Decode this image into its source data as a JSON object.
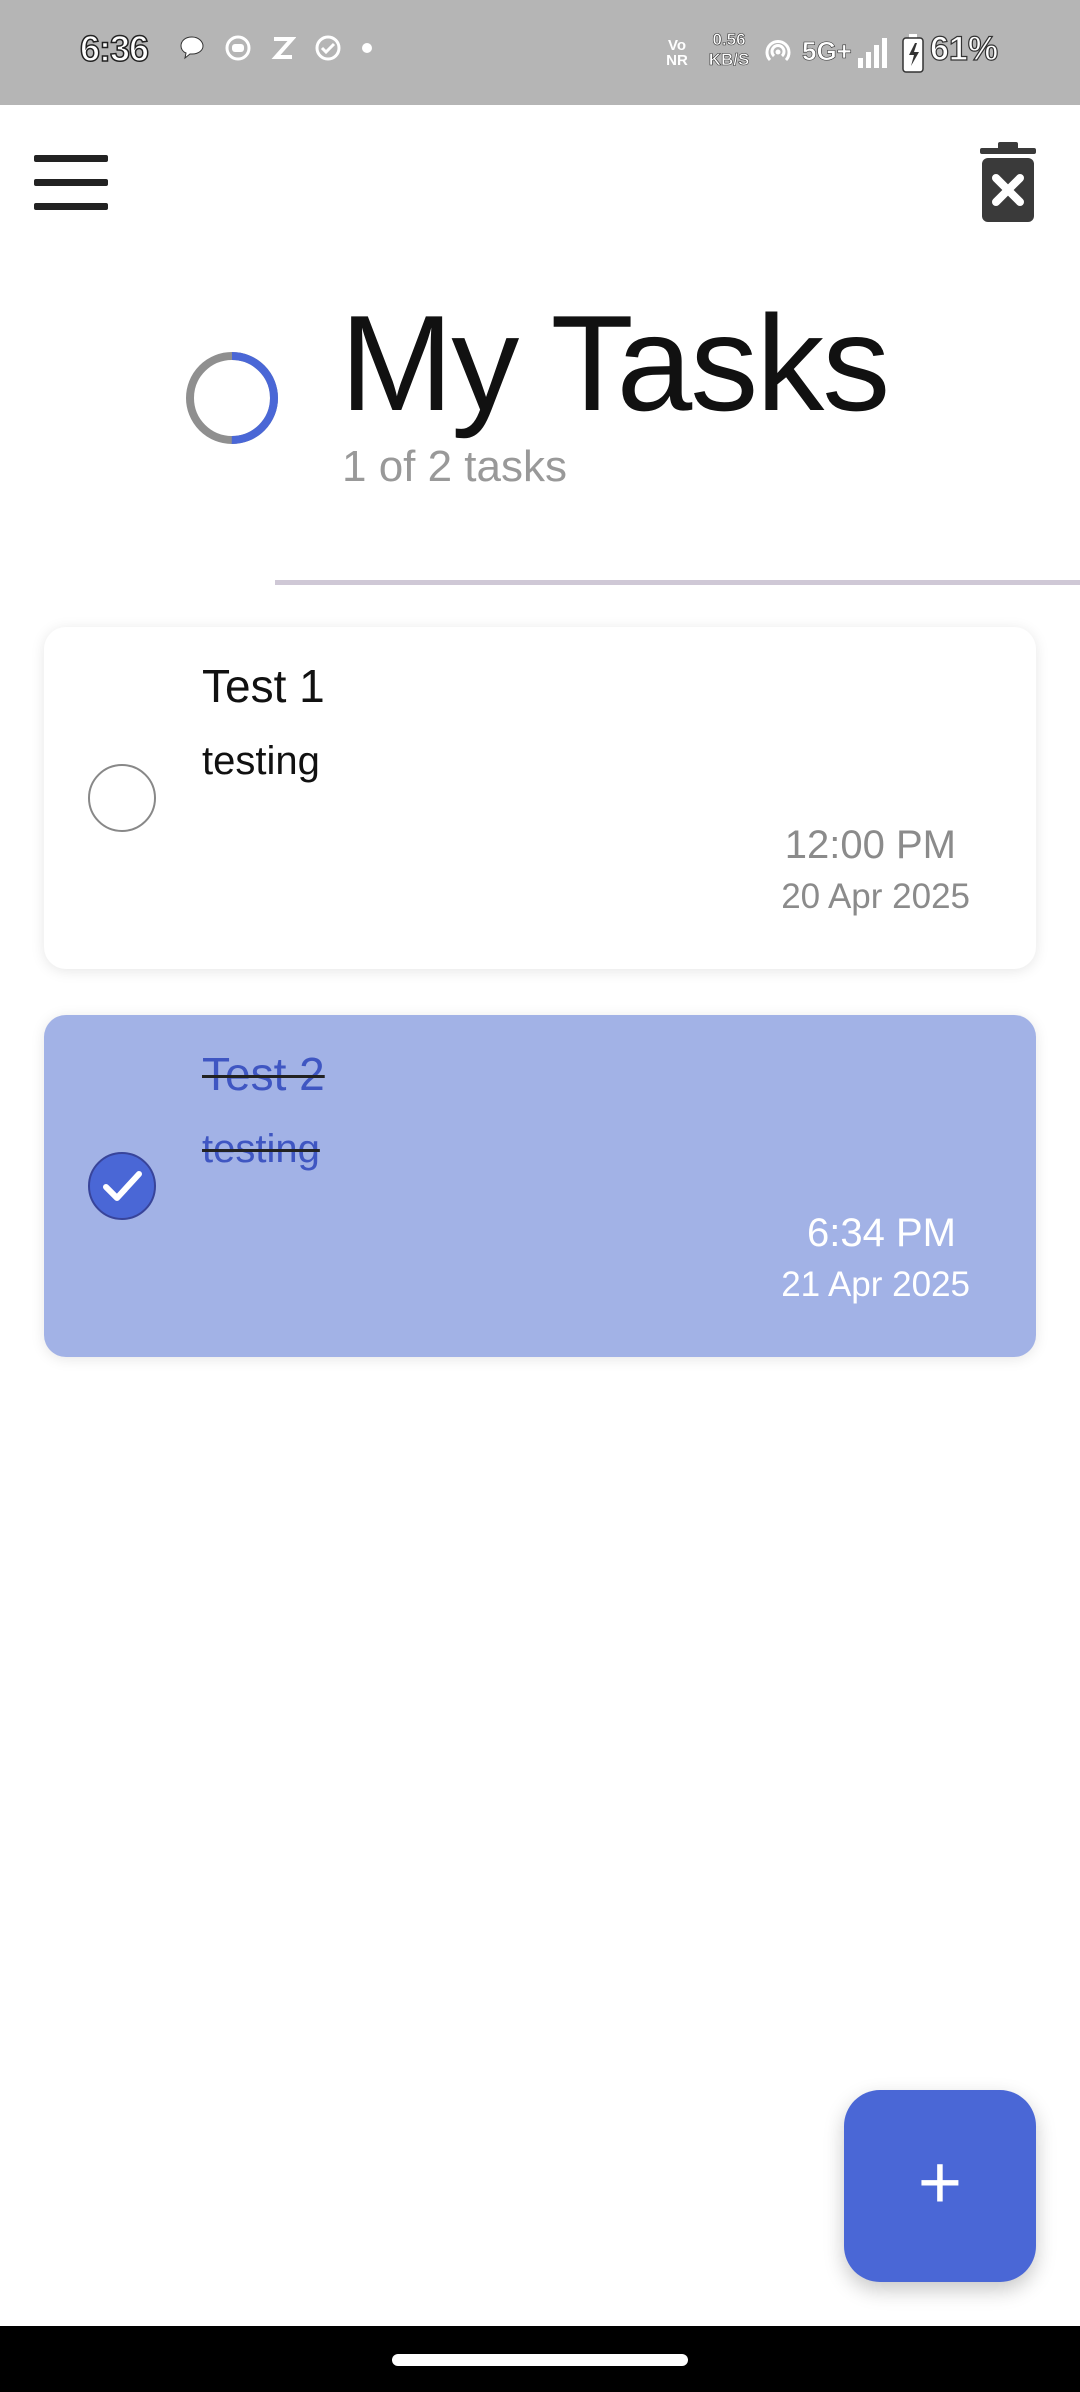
{
  "status_bar": {
    "time": "6:36",
    "vonr": "Vo NR",
    "speed_value": "0.56",
    "speed_unit": "KB/S",
    "network": "5G+",
    "battery": "61%"
  },
  "header": {
    "title": "My Tasks",
    "subtitle": "1 of 2 tasks",
    "progress_fraction": 0.5
  },
  "tasks": [
    {
      "title": "Test 1",
      "description": "testing",
      "time": "12:00 PM",
      "date": "20 Apr 2025",
      "completed": false
    },
    {
      "title": "Test 2",
      "description": "testing",
      "time": "6:34 PM",
      "date": "21 Apr 2025",
      "completed": true
    }
  ],
  "fab": {
    "label": "+"
  },
  "icons": {
    "menu": "hamburger-menu-icon",
    "delete_all": "trash-x-icon",
    "add": "plus-icon",
    "check": "check-icon"
  },
  "colors": {
    "accent": "#4a67d6",
    "completed_card": "#a2b2e6",
    "status_bar": "#b5b5b5"
  }
}
